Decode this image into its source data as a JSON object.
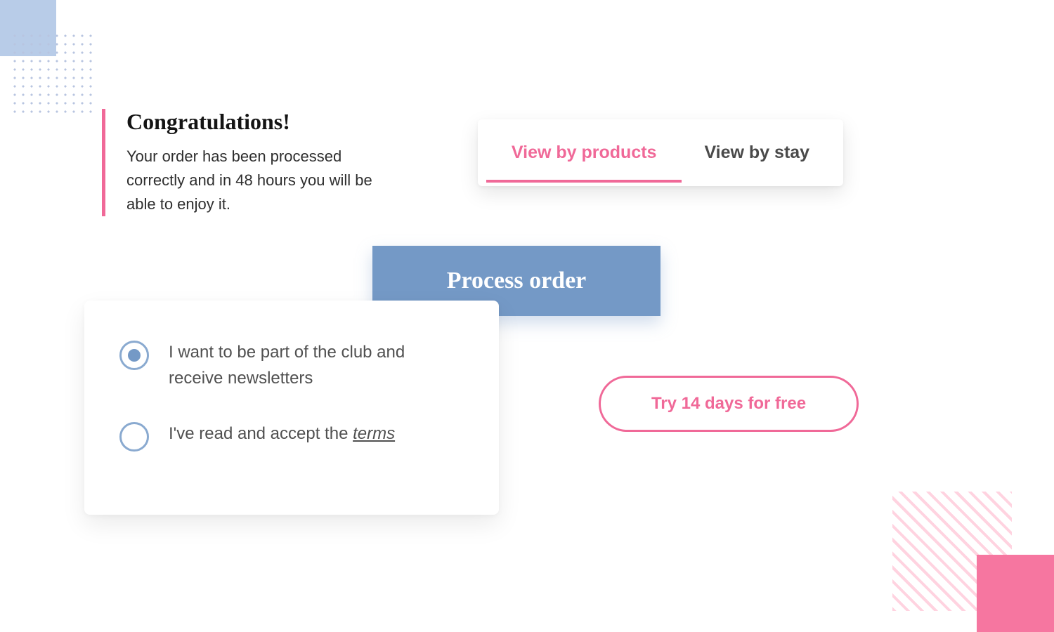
{
  "colors": {
    "accent_pink": "#f06998",
    "accent_blue": "#7499c6",
    "light_blue": "#b8cce8"
  },
  "congrats": {
    "title": "Congratulations!",
    "body": "Your order has been processed correctly and in 48 hours you will be able to enjoy it."
  },
  "tabs": {
    "active_label": "View by products",
    "inactive_label": "View by stay"
  },
  "primary_button": {
    "label": "Process order"
  },
  "radio_options": {
    "option1": "I want to be part of the club and receive newsletters",
    "option2_prefix": "I've read and accept the ",
    "option2_terms": "terms"
  },
  "outline_button": {
    "label": "Try 14 days for free"
  }
}
